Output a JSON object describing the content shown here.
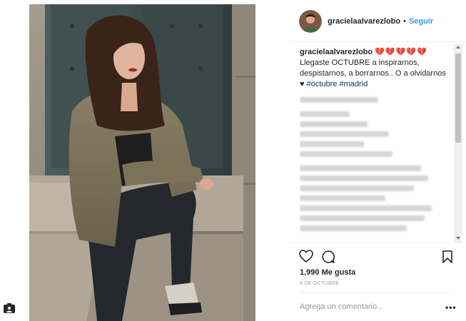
{
  "post": {
    "username": "gracielaalvarezlobo",
    "separator": "•",
    "follow_label": "Seguir",
    "caption": {
      "username": "gracielaalvarezlobo",
      "hearts": "💔💔💔💔💔",
      "text": "Llegaste OCTUBRE a inspirarnos, despistarnos, a borrarnos.. O a olvidarnos ♥",
      "hashtags": "#octubre #madrid"
    },
    "likes": "1,990 Me gusta",
    "date": "9 DE OCTUBRE",
    "comment_placeholder": "Agrega un comentario...",
    "more_label": "•••"
  },
  "icons": {
    "like": "heart-icon",
    "comment": "comment-icon",
    "save": "bookmark-icon",
    "corner": "camera-icon"
  },
  "colors": {
    "link": "#3897f0",
    "hashtag": "#003569",
    "muted": "#999999",
    "text": "#262626"
  }
}
